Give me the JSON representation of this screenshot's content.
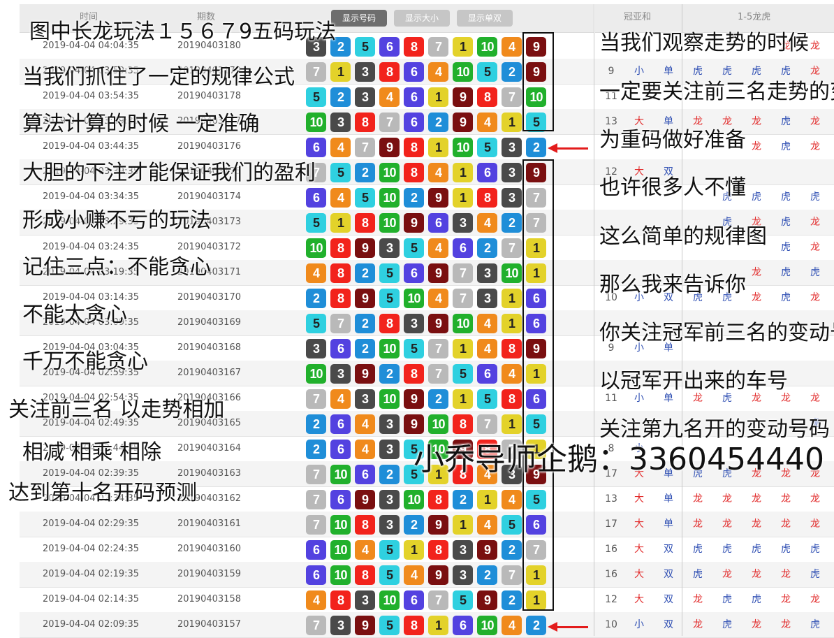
{
  "header": {
    "col_time": "时间",
    "col_issue": "期数",
    "btn_numbers": "显示号码",
    "btn_size": "显示大小",
    "btn_parity": "显示单双",
    "col_sum": "冠亚和",
    "col_dragon_tiger": "1-5龙虎"
  },
  "colors": {
    "1": "#e3d22a",
    "2": "#1f8ed8",
    "3": "#4a4a4a",
    "4": "#f08a1c",
    "5": "#2fd0e0",
    "6": "#5342e0",
    "7": "#b9b9b9",
    "8": "#f2231c",
    "9": "#7a0f10",
    "10": "#21b02c",
    "red_text": "#e22b2b",
    "blue_text": "#2f4fb3",
    "box_border": "#111111"
  },
  "rows": [
    {
      "time": "2019-04-04 04:04:35",
      "issue": "20190403180",
      "balls": [
        3,
        2,
        5,
        6,
        8,
        7,
        1,
        10,
        4,
        9
      ],
      "sum": "",
      "size": "",
      "parity": "",
      "dt": [
        "",
        "",
        "",
        "龙",
        "龙"
      ]
    },
    {
      "time": "2019-04-04 03:59:35",
      "issue": "20190403179",
      "balls": [
        7,
        1,
        3,
        8,
        6,
        4,
        10,
        5,
        2,
        9
      ],
      "sum": "9",
      "size": "小",
      "parity": "单",
      "dt": [
        "虎",
        "虎",
        "虎",
        "虎",
        "龙"
      ]
    },
    {
      "time": "2019-04-04 03:54:35",
      "issue": "20190403178",
      "balls": [
        5,
        2,
        3,
        4,
        6,
        1,
        9,
        8,
        7,
        10
      ],
      "sum": "11",
      "size": "",
      "parity": "",
      "dt": [
        "",
        "",
        "",
        "",
        ""
      ]
    },
    {
      "time": "2019-04-04 03:49:35",
      "issue": "20190403177",
      "balls": [
        10,
        3,
        8,
        7,
        6,
        2,
        9,
        4,
        1,
        5
      ],
      "sum": "13",
      "size": "大",
      "parity": "单",
      "dt": [
        "龙",
        "龙",
        "龙",
        "虎",
        "龙"
      ]
    },
    {
      "time": "2019-04-04 03:44:35",
      "issue": "20190403176",
      "balls": [
        6,
        4,
        7,
        9,
        8,
        1,
        10,
        5,
        3,
        2
      ],
      "sum": "",
      "size": "",
      "parity": "",
      "dt": [
        "",
        "",
        "龙",
        "虎",
        "龙"
      ]
    },
    {
      "time": "2019-04-04 03:39:35",
      "issue": "20190403175",
      "balls": [
        7,
        5,
        2,
        10,
        8,
        4,
        1,
        6,
        3,
        9
      ],
      "sum": "12",
      "size": "大",
      "parity": "双",
      "dt": [
        "",
        "",
        "",
        "",
        ""
      ]
    },
    {
      "time": "2019-04-04 03:34:35",
      "issue": "20190403174",
      "balls": [
        6,
        4,
        5,
        10,
        2,
        9,
        1,
        8,
        3,
        7
      ],
      "sum": "",
      "size": "",
      "parity": "",
      "dt": [
        "",
        "虎",
        "虎",
        "虎",
        "虎"
      ]
    },
    {
      "time": "2019-04-04 03:29:35",
      "issue": "20190403173",
      "balls": [
        5,
        1,
        8,
        10,
        9,
        6,
        3,
        4,
        2,
        7
      ],
      "sum": "",
      "size": "",
      "parity": "",
      "dt": [
        "",
        "虎",
        "龙",
        "虎",
        "龙"
      ]
    },
    {
      "time": "2019-04-04 03:24:35",
      "issue": "20190403172",
      "balls": [
        10,
        8,
        9,
        3,
        5,
        4,
        6,
        2,
        7,
        1
      ],
      "sum": "",
      "size": "",
      "parity": "",
      "dt": [
        "",
        "",
        "",
        "虎",
        "龙"
      ]
    },
    {
      "time": "2019-04-04 03:19:35",
      "issue": "20190403171",
      "balls": [
        4,
        8,
        2,
        5,
        6,
        9,
        7,
        3,
        10,
        1
      ],
      "sum": "",
      "size": "",
      "parity": "",
      "dt": [
        "",
        "",
        "龙",
        "虎",
        "虎"
      ]
    },
    {
      "time": "2019-04-04 03:14:35",
      "issue": "20190403170",
      "balls": [
        2,
        8,
        9,
        5,
        10,
        4,
        7,
        3,
        1,
        6
      ],
      "sum": "10",
      "size": "小",
      "parity": "双",
      "dt": [
        "虎",
        "虎",
        "龙",
        "虎",
        "龙"
      ]
    },
    {
      "time": "2019-04-04 03:09:35",
      "issue": "20190403169",
      "balls": [
        5,
        7,
        2,
        8,
        3,
        9,
        10,
        4,
        1,
        6
      ],
      "sum": "",
      "size": "",
      "parity": "",
      "dt": [
        "",
        "",
        "",
        "",
        ""
      ]
    },
    {
      "time": "2019-04-04 03:04:35",
      "issue": "20190403168",
      "balls": [
        3,
        6,
        2,
        10,
        5,
        7,
        1,
        4,
        8,
        9
      ],
      "sum": "9",
      "size": "小",
      "parity": "单",
      "dt": [
        "",
        "",
        "",
        "",
        ""
      ]
    },
    {
      "time": "2019-04-04 02:59:35",
      "issue": "20190403167",
      "balls": [
        10,
        3,
        9,
        2,
        8,
        7,
        5,
        6,
        4,
        1
      ],
      "sum": "",
      "size": "",
      "parity": "",
      "dt": [
        "",
        "",
        "",
        "",
        ""
      ]
    },
    {
      "time": "2019-04-04 02:54:35",
      "issue": "20190403166",
      "balls": [
        7,
        4,
        3,
        10,
        9,
        2,
        1,
        5,
        8,
        6
      ],
      "sum": "11",
      "size": "小",
      "parity": "单",
      "dt": [
        "龙",
        "虎",
        "龙",
        "龙",
        "龙"
      ]
    },
    {
      "time": "2019-04-04 02:49:35",
      "issue": "20190403165",
      "balls": [
        2,
        6,
        4,
        3,
        9,
        10,
        8,
        7,
        1,
        5
      ],
      "sum": "",
      "size": "",
      "parity": "",
      "dt": [
        "",
        "",
        "",
        "",
        "虎"
      ]
    },
    {
      "time": "2019-04-04 02:44:35",
      "issue": "20190403164",
      "balls": [
        2,
        6,
        4,
        3,
        5,
        10,
        9,
        8,
        7,
        1
      ],
      "sum": "8",
      "size": "小",
      "parity": "",
      "dt": [
        "",
        "",
        "",
        "",
        ""
      ]
    },
    {
      "time": "2019-04-04 02:39:35",
      "issue": "20190403163",
      "balls": [
        7,
        10,
        6,
        2,
        5,
        1,
        8,
        4,
        3,
        9
      ],
      "sum": "17",
      "size": "大",
      "parity": "单",
      "dt": [
        "虎",
        "虎",
        "龙",
        "龙",
        "龙"
      ]
    },
    {
      "time": "2019-04-04 02:34:35",
      "issue": "20190403162",
      "balls": [
        7,
        6,
        9,
        3,
        10,
        8,
        2,
        1,
        4,
        5
      ],
      "sum": "13",
      "size": "大",
      "parity": "单",
      "dt": [
        "龙",
        "龙",
        "龙",
        "龙",
        "龙"
      ]
    },
    {
      "time": "2019-04-04 02:29:35",
      "issue": "20190403161",
      "balls": [
        7,
        10,
        8,
        3,
        2,
        9,
        1,
        4,
        5,
        6
      ],
      "sum": "17",
      "size": "大",
      "parity": "单",
      "dt": [
        "龙",
        "龙",
        "龙",
        "龙",
        "龙"
      ]
    },
    {
      "time": "2019-04-04 02:24:35",
      "issue": "20190403160",
      "balls": [
        6,
        10,
        4,
        5,
        1,
        8,
        3,
        9,
        2,
        7
      ],
      "sum": "16",
      "size": "大",
      "parity": "双",
      "dt": [
        "虎",
        "虎",
        "虎",
        "虎",
        "虎"
      ]
    },
    {
      "time": "2019-04-04 02:19:35",
      "issue": "20190403159",
      "balls": [
        6,
        10,
        8,
        5,
        4,
        9,
        3,
        2,
        7,
        1
      ],
      "sum": "16",
      "size": "大",
      "parity": "双",
      "dt": [
        "虎",
        "龙",
        "龙",
        "龙",
        "虎"
      ]
    },
    {
      "time": "2019-04-04 02:14:35",
      "issue": "20190403158",
      "balls": [
        4,
        8,
        3,
        10,
        6,
        7,
        5,
        9,
        2,
        1
      ],
      "sum": "12",
      "size": "大",
      "parity": "双",
      "dt": [
        "龙",
        "虎",
        "虎",
        "龙",
        "龙"
      ]
    },
    {
      "time": "2019-04-04 02:09:35",
      "issue": "20190403157",
      "balls": [
        7,
        3,
        9,
        5,
        8,
        1,
        6,
        10,
        4,
        2
      ],
      "sum": "10",
      "size": "小",
      "parity": "双",
      "dt": [
        "龙",
        "虎",
        "龙",
        "龙",
        "虎"
      ]
    }
  ],
  "overlay_left": [
    "图中长龙玩法１５６７9五码玩法",
    "当我们抓住了一定的规律公式",
    "算法计算的时候 一定准确",
    "大胆的下注才能保证我们的盈利",
    "形成小赚不亏的玩法",
    "记住三点：不能贪心",
    "不能太贪心",
    "千万不能贪心",
    "关注前三名  以走势相加",
    "相减  相乘  相除",
    "达到第十名开码预测"
  ],
  "overlay_right": [
    "当我们观察走势的时候",
    "一定要关注前三名走势的变动",
    "为重码做好准备",
    "也许很多人不懂",
    "这么简单的规律图",
    "那么我来告诉你",
    "你关注冠军前三名的变动号码",
    "以冠军开出来的车号",
    "关注第九名开的变动号码"
  ],
  "contact": "小乔导师企鹅：3360454440"
}
